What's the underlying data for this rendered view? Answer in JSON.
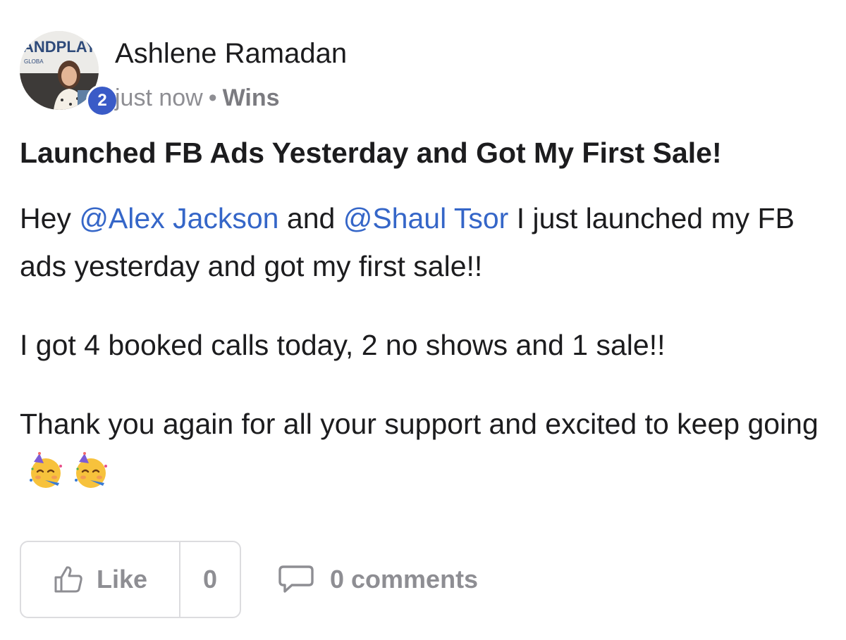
{
  "author": {
    "name": "Ashlene Ramadan",
    "avatar_text": "ANDPLAY",
    "avatar_subtext": "GLOBA",
    "level": "2"
  },
  "meta": {
    "time": "just now",
    "separator": "•",
    "category": "Wins"
  },
  "post": {
    "title": "Launched FB Ads Yesterday and Got My First Sale!",
    "p1_start": "Hey ",
    "mention1": "@Alex Jackson",
    "p1_and": " and ",
    "mention2": "@Shaul Tsor",
    "p1_end": " I just launched my FB ads yesterday and got my first sale!!",
    "p2": "I got 4 booked calls today, 2 no shows and 1 sale!!",
    "p3": "Thank you again for all your support and excited to keep going",
    "emoji_name": "partying-face-emoji"
  },
  "actions": {
    "like_label": "Like",
    "like_count": "0",
    "comments_label": "0 comments"
  },
  "colors": {
    "mention": "#3566c8",
    "badge": "#3a5bc7",
    "muted": "#8e8e93"
  }
}
